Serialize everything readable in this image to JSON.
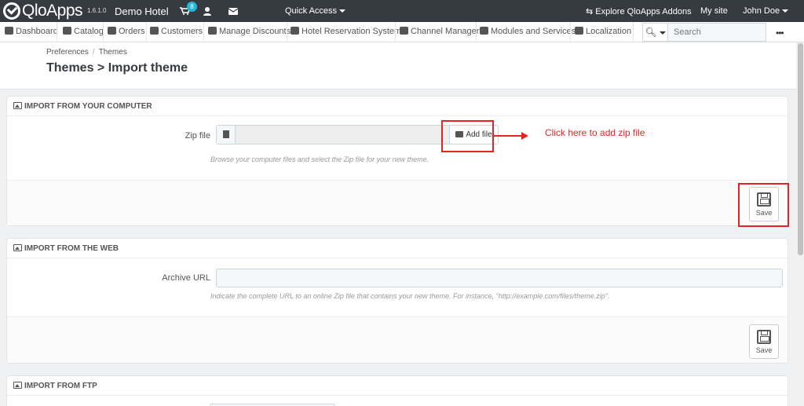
{
  "topbar": {
    "brand": "QloApps",
    "version": "1.6.1.0",
    "shop_name": "Demo Hotel",
    "cart_badge": "8",
    "quick_access": "Quick Access",
    "explore": "Explore QloApps Addons",
    "mysite": "My site",
    "employee": "John  Doe"
  },
  "nav": {
    "items": [
      {
        "label": "Dashboard",
        "icon": "dashboard-icon"
      },
      {
        "label": "Catalog",
        "icon": "book-icon"
      },
      {
        "label": "Orders",
        "icon": "credit-card-icon"
      },
      {
        "label": "Customers",
        "icon": "users-icon"
      },
      {
        "label": "Manage Discounts",
        "icon": "tag-icon"
      },
      {
        "label": "Hotel Reservation System",
        "icon": "bed-icon"
      },
      {
        "label": "Channel Manager",
        "icon": "refresh-icon"
      },
      {
        "label": "Modules and Services",
        "icon": "puzzle-icon"
      },
      {
        "label": "Localization",
        "icon": "globe-icon"
      }
    ],
    "search_placeholder": "Search"
  },
  "pagehead": {
    "breadcrumb": [
      "Preferences",
      "Themes"
    ],
    "title": "Themes > Import theme"
  },
  "panels": {
    "computer": {
      "heading": "Import from your computer",
      "label": "Zip file",
      "add_file": "Add file",
      "help": "Browse your computer files and select the Zip file for your new theme.",
      "save": "Save"
    },
    "web": {
      "heading": "Import from the web",
      "label": "Archive URL",
      "help": "Indicate the complete URL to an online Zip file that contains your new theme. For instance, \"http://example.com/files/theme.zip\".",
      "save": "Save"
    },
    "ftp": {
      "heading": "Import from FTP"
    }
  },
  "annotation": {
    "text": "Click here to add zip file",
    "color": "#e52324"
  },
  "colors": {
    "topbar": "#363a41",
    "accent": "#25b9d7"
  }
}
